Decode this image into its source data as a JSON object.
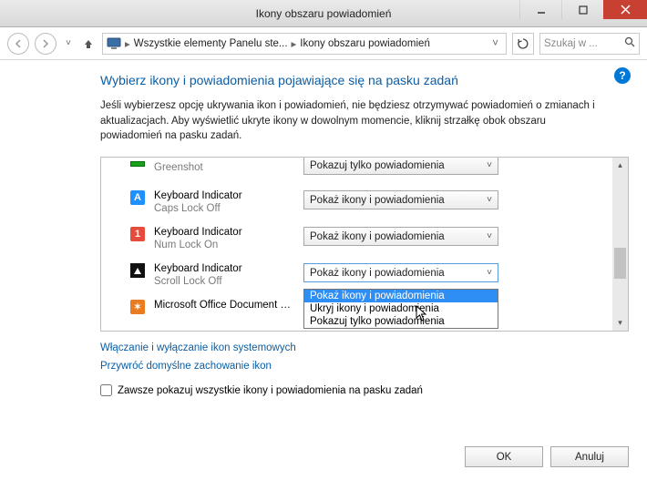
{
  "window": {
    "title": "Ikony obszaru powiadomień"
  },
  "nav": {
    "breadcrumb_root": "Wszystkie elementy Panelu ste...",
    "breadcrumb_current": "Ikony obszaru powiadomień",
    "search_placeholder": "Szukaj w ..."
  },
  "page": {
    "heading": "Wybierz ikony i powiadomienia pojawiające się na pasku zadań",
    "description": "Jeśli wybierzesz opcję ukrywania ikon i powiadomień, nie będziesz otrzymywać powiadomień o zmianach i aktualizacjach. Aby wyświetlić ukryte ikony w dowolnym momencie, kliknij strzałkę obok obszaru powiadomień na pasku zadań."
  },
  "items": [
    {
      "name": "Greenshot",
      "sub": "",
      "behavior": "Pokazuj tylko powiadomienia"
    },
    {
      "name": "Keyboard Indicator",
      "sub": "Caps Lock Off",
      "behavior": "Pokaż ikony i powiadomienia"
    },
    {
      "name": "Keyboard Indicator",
      "sub": "Num Lock On",
      "behavior": "Pokaż ikony i powiadomienia"
    },
    {
      "name": "Keyboard Indicator",
      "sub": "Scroll Lock Off",
      "behavior": "Pokaż ikony i powiadomienia"
    },
    {
      "name": "Microsoft Office Document …",
      "sub": "",
      "behavior": ""
    }
  ],
  "dropdown": {
    "options": [
      "Pokaż ikony i powiadomienia",
      "Ukryj ikony i powiadomienia",
      "Pokazuj tylko powiadomienia"
    ]
  },
  "links": {
    "system_icons": "Włączanie i wyłączanie ikon systemowych",
    "restore_defaults": "Przywróć domyślne zachowanie ikon"
  },
  "checkbox": {
    "label": "Zawsze pokazuj wszystkie ikony i powiadomienia na pasku zadań"
  },
  "buttons": {
    "ok": "OK",
    "cancel": "Anuluj"
  }
}
